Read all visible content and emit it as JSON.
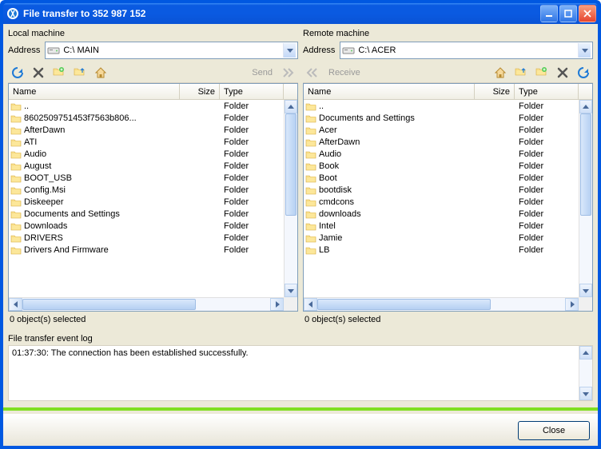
{
  "title": "File transfer to 352 987 152",
  "local": {
    "header": "Local machine",
    "address_label": "Address",
    "address_value": "C:\\  MAIN",
    "send_label": "Send",
    "col_name": "Name",
    "col_size": "Size",
    "col_type": "Type",
    "status": "0 object(s) selected",
    "items": [
      {
        "name": "..",
        "type": "Folder"
      },
      {
        "name": "8602509751453f7563b806...",
        "type": "Folder"
      },
      {
        "name": "AfterDawn",
        "type": "Folder"
      },
      {
        "name": "ATI",
        "type": "Folder"
      },
      {
        "name": "Audio",
        "type": "Folder"
      },
      {
        "name": "August",
        "type": "Folder"
      },
      {
        "name": "BOOT_USB",
        "type": "Folder"
      },
      {
        "name": "Config.Msi",
        "type": "Folder"
      },
      {
        "name": "Diskeeper",
        "type": "Folder"
      },
      {
        "name": "Documents and Settings",
        "type": "Folder"
      },
      {
        "name": "Downloads",
        "type": "Folder"
      },
      {
        "name": "DRIVERS",
        "type": "Folder"
      },
      {
        "name": "Drivers And Firmware",
        "type": "Folder"
      }
    ]
  },
  "remote": {
    "header": "Remote machine",
    "address_label": "Address",
    "address_value": "C:\\  ACER",
    "receive_label": "Receive",
    "col_name": "Name",
    "col_size": "Size",
    "col_type": "Type",
    "status": "0 object(s) selected",
    "items": [
      {
        "name": "..",
        "type": "Folder"
      },
      {
        "name": "Documents and Settings",
        "type": "Folder"
      },
      {
        "name": "Acer",
        "type": "Folder"
      },
      {
        "name": "AfterDawn",
        "type": "Folder"
      },
      {
        "name": "Audio",
        "type": "Folder"
      },
      {
        "name": "Book",
        "type": "Folder"
      },
      {
        "name": "Boot",
        "type": "Folder"
      },
      {
        "name": "bootdisk",
        "type": "Folder"
      },
      {
        "name": "cmdcons",
        "type": "Folder"
      },
      {
        "name": "downloads",
        "type": "Folder"
      },
      {
        "name": "Intel",
        "type": "Folder"
      },
      {
        "name": "Jamie",
        "type": "Folder"
      },
      {
        "name": "LB",
        "type": "Folder"
      }
    ]
  },
  "log": {
    "label": "File transfer event log",
    "entry": "01:37:30: The connection has been established successfully."
  },
  "close_label": "Close"
}
